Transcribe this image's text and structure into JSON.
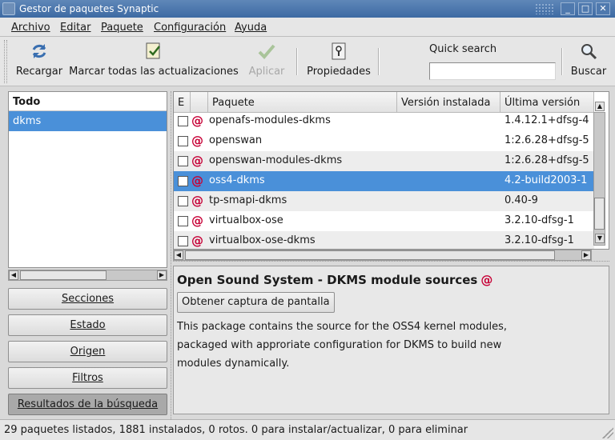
{
  "window": {
    "title": "Gestor de paquetes Synaptic",
    "controls": {
      "minimize": "_",
      "maximize": "□",
      "close": "✕"
    }
  },
  "menu": {
    "items": [
      "Archivo",
      "Editar",
      "Paquete",
      "Configuración",
      "Ayuda"
    ]
  },
  "toolbar": {
    "reload": "Recargar",
    "mark_all": "Marcar todas las actualizaciones",
    "apply": "Aplicar",
    "properties": "Propiedades",
    "quick_search_label": "Quick search",
    "quick_search_value": "",
    "search": "Buscar"
  },
  "sidebar": {
    "header": "Todo",
    "items": [
      {
        "label": "dkms",
        "selected": true
      }
    ]
  },
  "filters": {
    "sections": "Secciones",
    "status": "Estado",
    "origin": "Origen",
    "custom": "Filtros",
    "search_results": "Resultados de la búsqueda"
  },
  "package_table": {
    "columns": {
      "status": "E",
      "package": "Paquete",
      "installed": "Versión instalada",
      "latest": "Última versión"
    },
    "rows": [
      {
        "name": "openafs-modules-dkms",
        "installed": "",
        "latest": "1.4.12.1+dfsg-4",
        "selected": false
      },
      {
        "name": "openswan",
        "installed": "",
        "latest": "1:2.6.28+dfsg-5",
        "selected": false
      },
      {
        "name": "openswan-modules-dkms",
        "installed": "",
        "latest": "1:2.6.28+dfsg-5",
        "selected": false
      },
      {
        "name": "oss4-dkms",
        "installed": "",
        "latest": "4.2-build2003-1",
        "selected": true
      },
      {
        "name": "tp-smapi-dkms",
        "installed": "",
        "latest": "0.40-9",
        "selected": false
      },
      {
        "name": "virtualbox-ose",
        "installed": "",
        "latest": "3.2.10-dfsg-1",
        "selected": false
      },
      {
        "name": "virtualbox-ose-dkms",
        "installed": "",
        "latest": "3.2.10-dfsg-1",
        "selected": false
      }
    ]
  },
  "details": {
    "title": "Open Sound System - DKMS module sources",
    "screenshot_button": "Obtener captura de pantalla",
    "description_lines": [
      "This package contains the source for the OSS4 kernel modules,",
      "packaged with approriate configuration for DKMS to build new",
      "modules dynamically."
    ]
  },
  "status_bar": {
    "text": "29 paquetes listados, 1881 instalados, 0 rotos. 0 para instalar/actualizar, 0 para eliminar"
  },
  "colors": {
    "selection": "#4a90d9",
    "debian_swirl": "#c70036",
    "titlebar": "#3d6aa3"
  }
}
